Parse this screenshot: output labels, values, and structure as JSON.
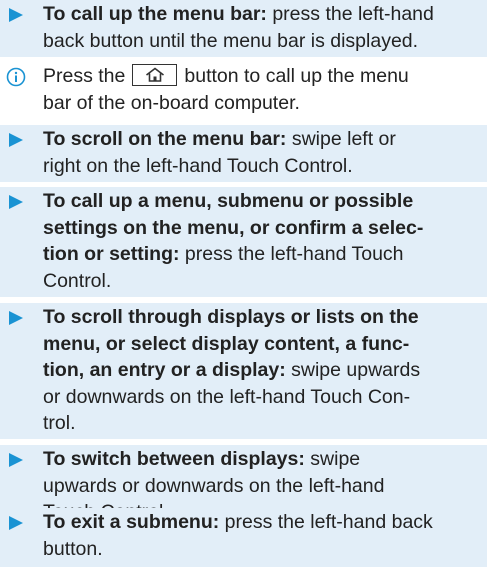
{
  "instructions": [
    {
      "type": "bullet",
      "lines": [
        {
          "bold": "To call up the menu bar:",
          "rest": " press the left-hand"
        },
        {
          "bold": "",
          "rest": "back button until the menu bar is displayed."
        }
      ]
    },
    {
      "type": "info",
      "icon": "info-circle-icon",
      "pre": "Press the",
      "button_icon": "home-icon",
      "post": "button to call up the menu",
      "line2": "bar of the on-board computer."
    },
    {
      "type": "bullet",
      "lines": [
        {
          "bold": "To scroll on the menu bar:",
          "rest": " swipe left or"
        },
        {
          "bold": "",
          "rest": "right on the left-hand Touch Control."
        }
      ]
    },
    {
      "type": "bullet",
      "lines": [
        {
          "bold": "To call up a menu, submenu or possible",
          "rest": ""
        },
        {
          "bold": "settings on the menu, or confirm a selec-",
          "rest": ""
        },
        {
          "bold": "tion or setting:",
          "rest": " press the left-hand Touch"
        },
        {
          "bold": "",
          "rest": "Control."
        }
      ]
    },
    {
      "type": "bullet",
      "lines": [
        {
          "bold": "To scroll through displays or lists on the",
          "rest": ""
        },
        {
          "bold": "menu, or select display content, a func-",
          "rest": ""
        },
        {
          "bold": "tion, an entry or a display:",
          "rest": " swipe upwards"
        },
        {
          "bold": "",
          "rest": "or downwards on the left-hand Touch Con-"
        },
        {
          "bold": "",
          "rest": "trol."
        }
      ]
    },
    {
      "type": "bullet",
      "lines": [
        {
          "bold": "To switch between displays:",
          "rest": " swipe"
        },
        {
          "bold": "",
          "rest": "upwards or downwards on the left-hand"
        },
        {
          "bold": "",
          "rest": "Touch Control."
        }
      ]
    },
    {
      "type": "bullet",
      "lines": [
        {
          "bold": "To exit a submenu:",
          "rest": " press the left-hand back"
        },
        {
          "bold": "",
          "rest": "button."
        }
      ]
    }
  ],
  "colors": {
    "bullet_bg": "#e2eef8",
    "arrow": "#1a93d3",
    "info_icon": "#1a93d3",
    "text": "#222222"
  }
}
